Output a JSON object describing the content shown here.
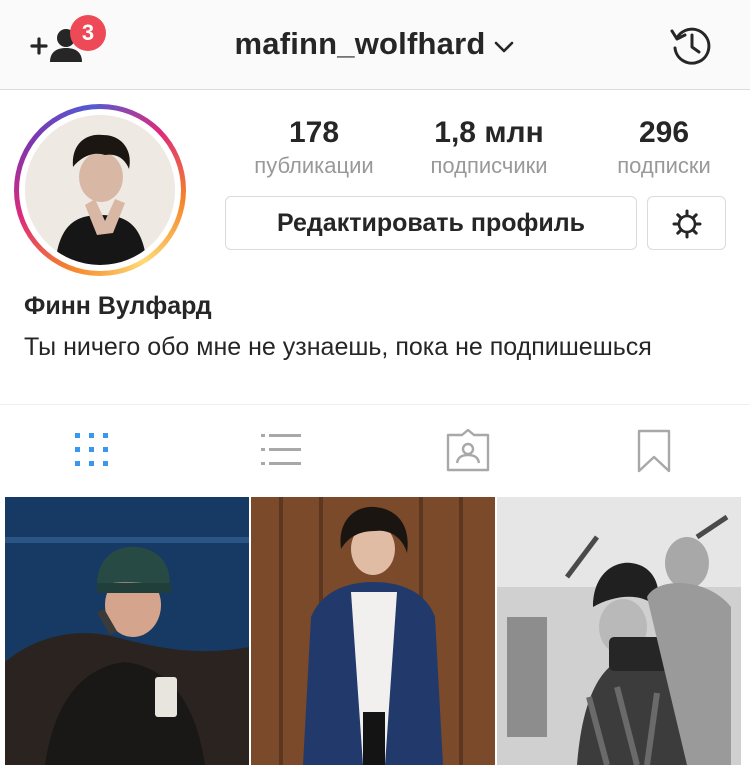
{
  "header": {
    "username": "mafinn_wolfhard",
    "notification_count": "3",
    "icons": {
      "left": "add-user-icon",
      "chevron": "chevron-down-icon",
      "right": "history-icon"
    }
  },
  "profile": {
    "full_name": "Финн Вулфард",
    "bio": "Ты ничего обо мне не узнаешь, пока не подпишешься",
    "stats": [
      {
        "value": "178",
        "label": "публикации"
      },
      {
        "value": "1,8 млн",
        "label": "подписчики"
      },
      {
        "value": "296",
        "label": "подписки"
      }
    ],
    "edit_button": "Редактировать профиль",
    "settings_icon": "gear-icon"
  },
  "tabs": [
    {
      "icon": "grid-icon",
      "active": true
    },
    {
      "icon": "list-icon",
      "active": false
    },
    {
      "icon": "tagged-icon",
      "active": false
    },
    {
      "icon": "bookmark-icon",
      "active": false
    }
  ],
  "colors": {
    "accent_blue": "#3897f0",
    "badge_red": "#ed4956",
    "text": "#262626",
    "muted": "#999999",
    "border": "#dbdbdb"
  }
}
